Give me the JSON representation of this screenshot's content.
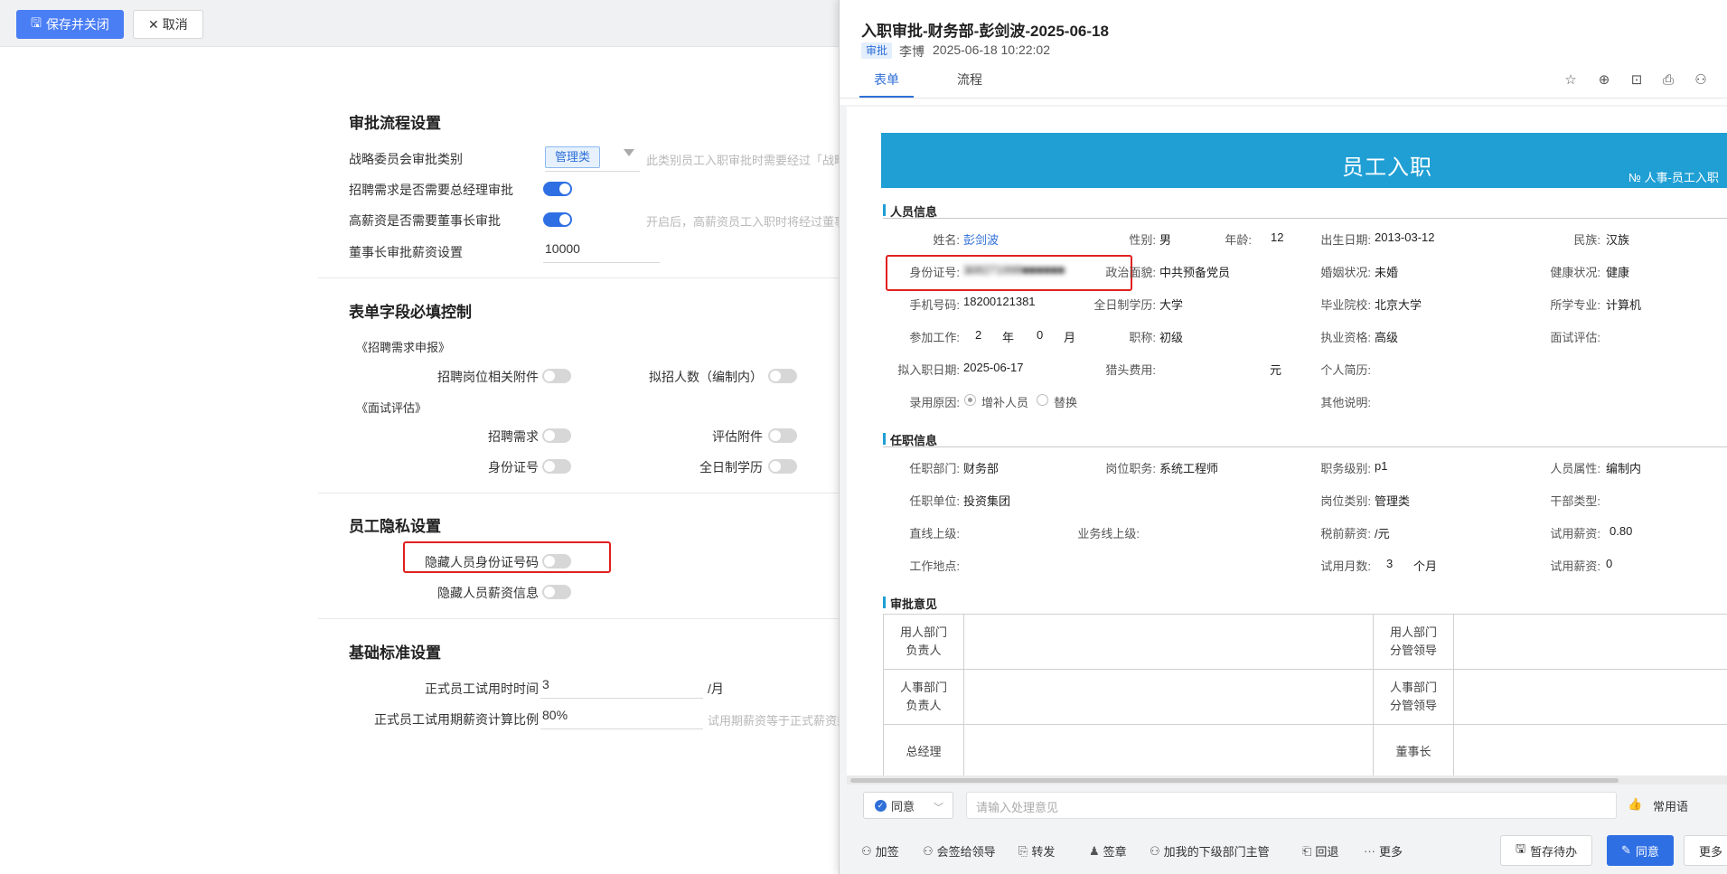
{
  "toolbar": {
    "save_close": "保存并关闭",
    "cancel": "取消"
  },
  "sections": {
    "approval_flow": {
      "title": "审批流程设置",
      "strategy_label": "战略委员会审批类别",
      "strategy_tag": "管理类",
      "strategy_hint": "此类别员工入职审批时需要经过「战略委员会」审批",
      "recruit_gm_label": "招聘需求是否需要总经理审批",
      "high_salary_label": "高薪资是否需要董事长审批",
      "high_salary_hint": "开启后，高薪资员工入职时将经过董事长审批",
      "chairman_salary_label": "董事长审批薪资设置",
      "chairman_salary_value": "10000"
    },
    "required_fields": {
      "title": "表单字段必填控制",
      "group1": "《招聘需求申报》",
      "attach_label": "招聘岗位相关附件",
      "headcount_label": "拟招人数（编制内）",
      "group2": "《面试评估》",
      "recruit_need_label": "招聘需求",
      "eval_attach_label": "评估附件",
      "id_label": "身份证号",
      "fulltime_label": "全日制学历"
    },
    "privacy": {
      "title": "员工隐私设置",
      "hide_id_label": "隐藏人员身份证号码",
      "hide_salary_label": "隐藏人员薪资信息"
    },
    "basic": {
      "title": "基础标准设置",
      "probation_time_label": "正式员工试用时时间",
      "probation_time_value": "3",
      "probation_time_unit": "/月",
      "probation_ratio_label": "正式员工试用期薪资计算比例",
      "probation_ratio_value": "80%",
      "probation_ratio_hint": "试用期薪资等于正式薪资乘以该比例"
    }
  },
  "approval": {
    "title": "入职审批-财务部-彭剑波-2025-06-18",
    "badge": "审批",
    "user": "李博",
    "time": "2025-06-18 10:22:02",
    "tab_form": "表单",
    "tab_flow": "流程",
    "icons": [
      "star-icon",
      "target-icon",
      "inbox-icon",
      "print-icon",
      "people-icon"
    ],
    "form": {
      "banner_title": "员工入职",
      "banner_no": "№   人事-员工入职",
      "sec_person": "人员信息",
      "name_l": "姓名:",
      "name_v": "彭剑波",
      "gender_l": "性别:",
      "gender_v": "男",
      "age_l": "年龄:",
      "age_v": "12",
      "birth_l": "出生日期:",
      "birth_v": "2013-03-12",
      "ethnic_l": "民族:",
      "ethnic_v": "汉族",
      "id_l": "身份证号:",
      "id_v": "3̶08271998■■■■■■",
      "politic_l": "政治面貌:",
      "politic_v": "中共预备党员",
      "marriage_l": "婚姻状况:",
      "marriage_v": "未婚",
      "health_l": "健康状况:",
      "health_v": "健康",
      "phone_l": "手机号码:",
      "phone_v": "18200121381",
      "edu_l": "全日制学历:",
      "edu_v": "大学",
      "school_l": "毕业院校:",
      "school_v": "北京大学",
      "major_l": "所学专业:",
      "major_v": "计算机",
      "work_l": "参加工作:",
      "work_y": "2",
      "work_y_unit": "年",
      "work_m": "0",
      "work_m_unit": "月",
      "title_l": "职称:",
      "title_v": "初级",
      "qual_l": "执业资格:",
      "qual_v": "高级",
      "interview_l": "面试评估:",
      "entry_l": "拟入职日期:",
      "entry_v": "2025-06-17",
      "hunter_l": "猎头费用:",
      "hunter_unit": "元",
      "resume_l": "个人简历:",
      "reason_l": "录用原因:",
      "reason_opt1": "增补人员",
      "reason_opt2": "替换",
      "other_l": "其他说明:",
      "sec_job": "任职信息",
      "dept_l": "任职部门:",
      "dept_v": "财务部",
      "post_l": "岗位职务:",
      "post_v": "系统工程师",
      "level_l": "职务级别:",
      "level_v": "p1",
      "attr_l": "人员属性:",
      "attr_v": "编制内",
      "unit_l": "任职单位:",
      "unit_v": "投资集团",
      "posttype_l": "岗位类别:",
      "posttype_v": "管理类",
      "cadre_l": "干部类型:",
      "superior_l": "直线上级:",
      "biz_l": "业务线上级:",
      "pretax_l": "税前薪资:",
      "pretax_v": "/元",
      "trial_salary_l": "试用薪资:",
      "trial_salary_v": "0.80",
      "place_l": "工作地点:",
      "trial_month_l": "试用月数:",
      "trial_month_v": "3",
      "trial_month_unit": "个月",
      "trial_salary2_l": "试用薪资:",
      "trial_salary2_v": "0",
      "sec_opinion": "审批意见",
      "op_user_dept": "用人部门\n负责人",
      "op_user_lead": "用人部门\n分管领导",
      "op_hr_dept": "人事部门\n负责人",
      "op_hr_lead": "人事部门\n分管领导",
      "op_gm": "总经理",
      "op_chairman": "董事长"
    },
    "footer": {
      "agree_select": "同意",
      "opinion_placeholder": "请输入处理意见",
      "common_phrase": "常用语",
      "actions": [
        "加签",
        "会签给领导",
        "转发",
        "签章",
        "加我的下级部门主管",
        "回退",
        "更多"
      ],
      "btn_save_pending": "暂存待办",
      "btn_agree": "同意",
      "btn_more": "更多"
    }
  }
}
